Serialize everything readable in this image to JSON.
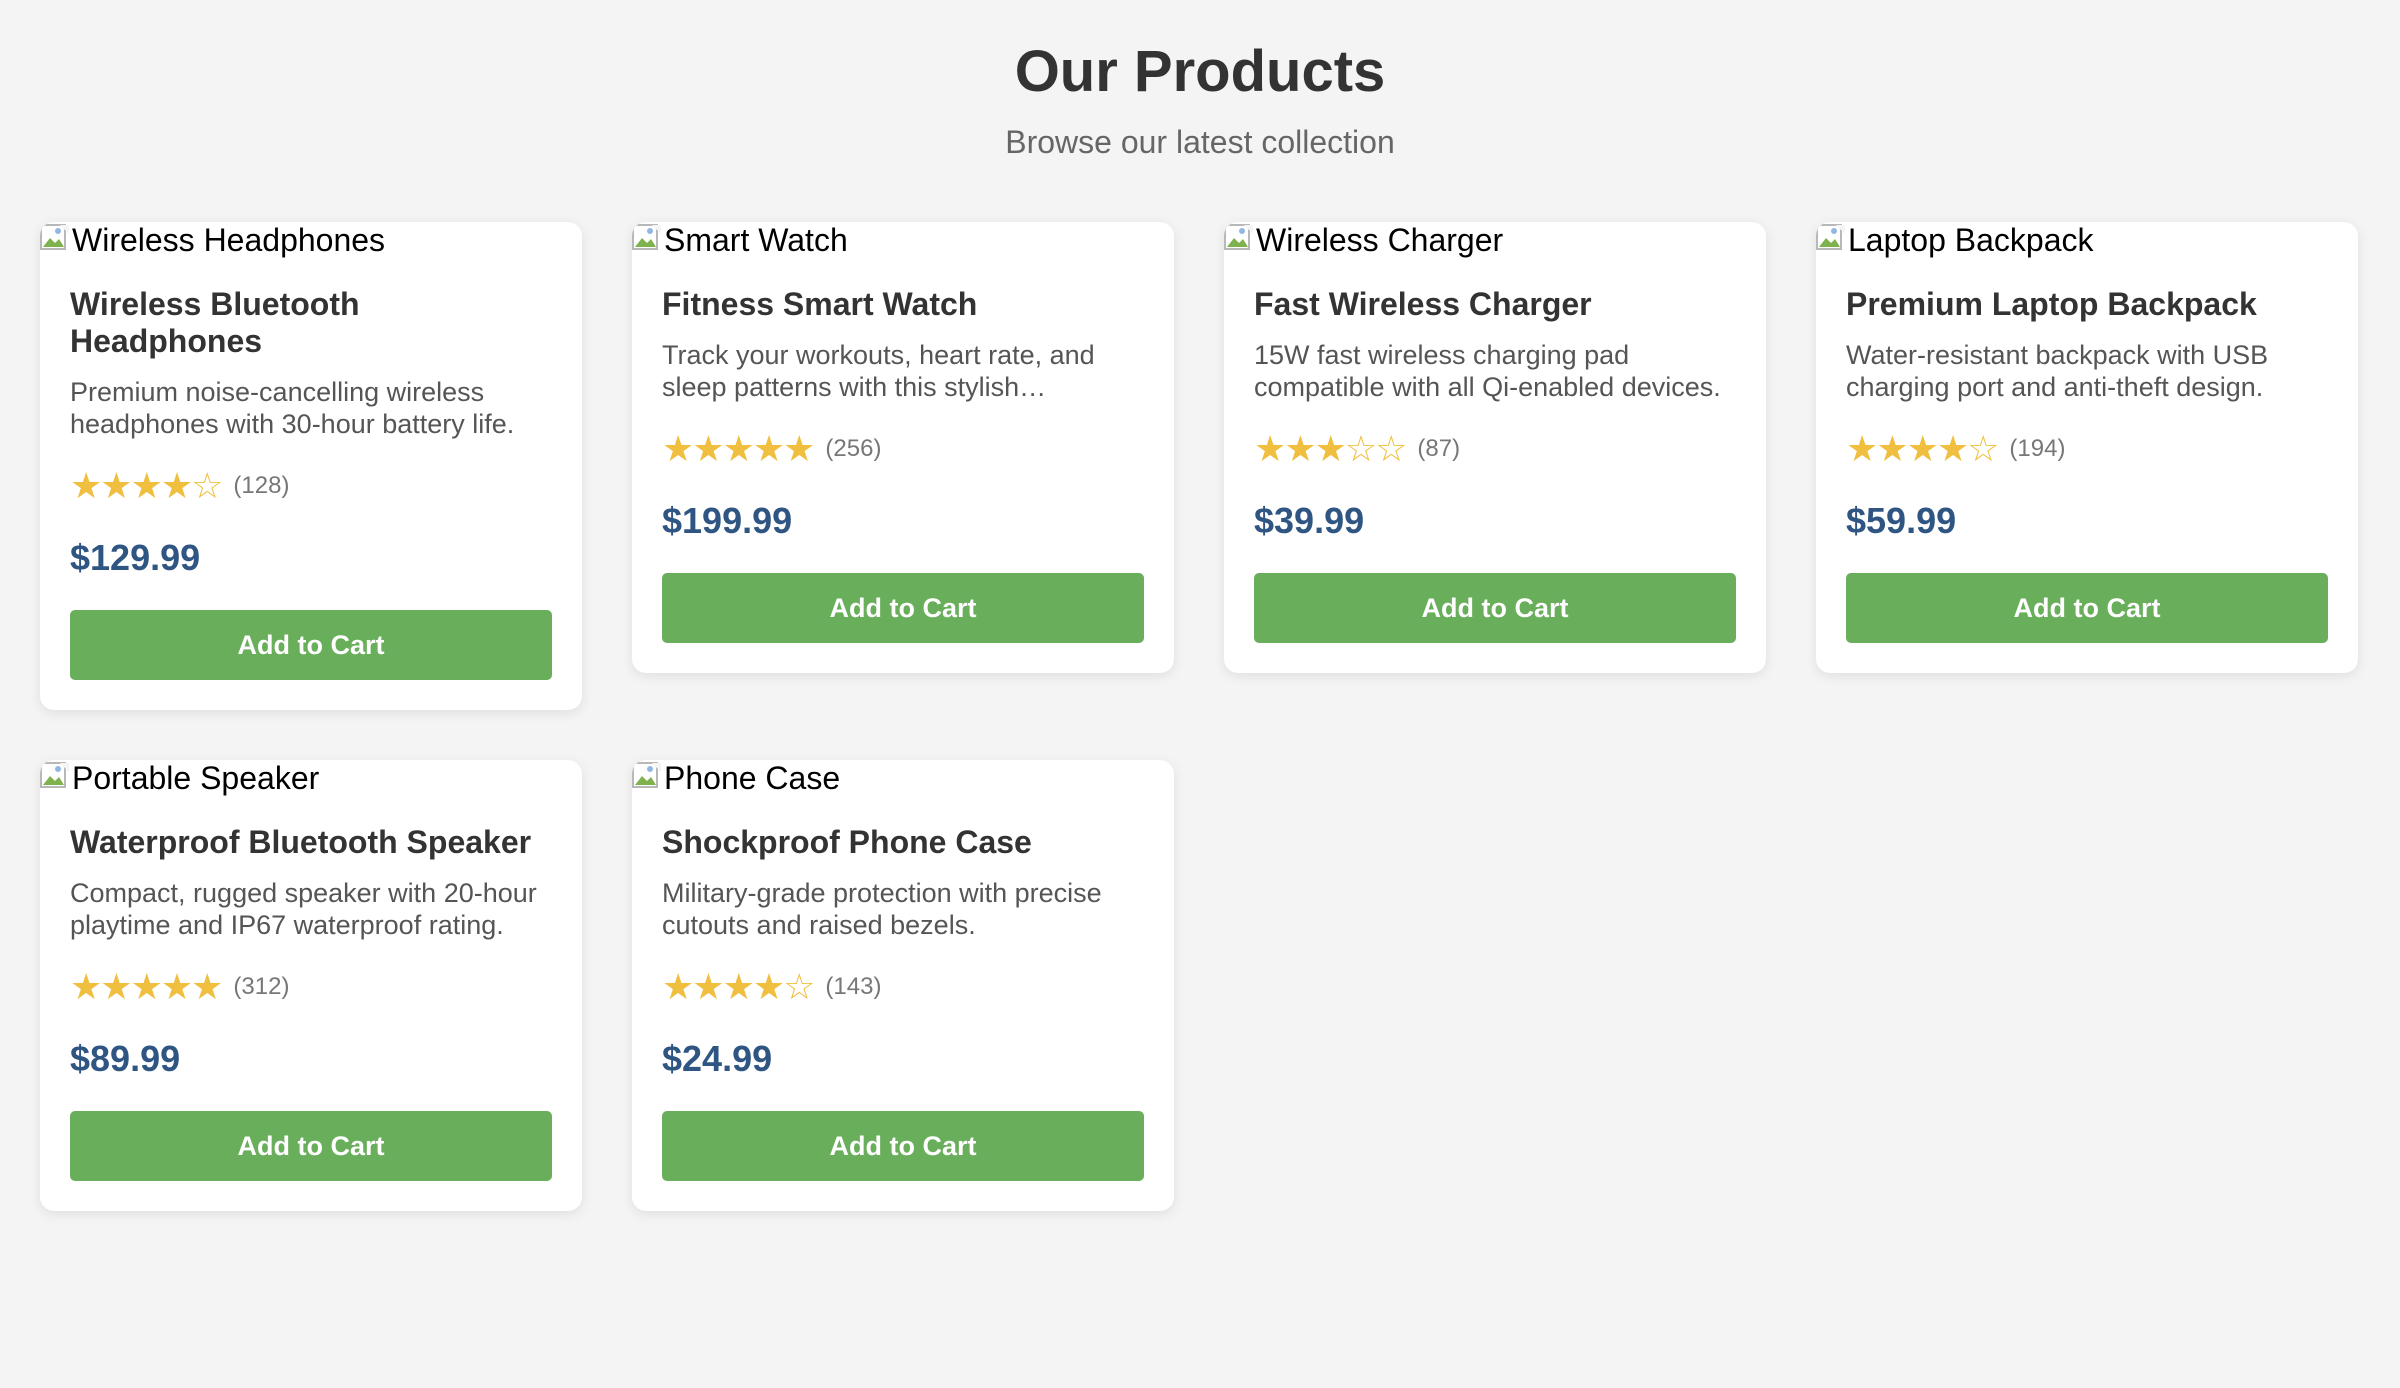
{
  "header": {
    "title": "Our Products",
    "subtitle": "Browse our latest collection"
  },
  "colors": {
    "background": "#f4f4f4",
    "price": "#2f5583",
    "button": "#69ae5a",
    "star": "#f0bf3f"
  },
  "icons": {
    "broken_image": "broken-image-icon",
    "star_filled": "star-filled-icon",
    "star_empty": "star-empty-icon"
  },
  "products": [
    {
      "image_alt": "Wireless Headphones",
      "name": "Wireless Bluetooth Headphones",
      "description": "Premium noise-cancelling wireless headphones with 30-hour battery life.",
      "rating": 4,
      "rating_max": 5,
      "review_count": "(128)",
      "price": "$129.99",
      "button_label": "Add to Cart"
    },
    {
      "image_alt": "Smart Watch",
      "name": "Fitness Smart Watch",
      "description": "Track your workouts, heart rate, and sleep patterns with this stylish smartwatch.",
      "rating": 5,
      "rating_max": 5,
      "review_count": "(256)",
      "price": "$199.99",
      "button_label": "Add to Cart"
    },
    {
      "image_alt": "Wireless Charger",
      "name": "Fast Wireless Charger",
      "description": "15W fast wireless charging pad compatible with all Qi-enabled devices.",
      "rating": 3,
      "rating_max": 5,
      "review_count": "(87)",
      "price": "$39.99",
      "button_label": "Add to Cart"
    },
    {
      "image_alt": "Laptop Backpack",
      "name": "Premium Laptop Backpack",
      "description": "Water-resistant backpack with USB charging port and anti-theft design.",
      "rating": 4,
      "rating_max": 5,
      "review_count": "(194)",
      "price": "$59.99",
      "button_label": "Add to Cart"
    },
    {
      "image_alt": "Portable Speaker",
      "name": "Waterproof Bluetooth Speaker",
      "description": "Compact, rugged speaker with 20-hour playtime and IP67 waterproof rating.",
      "rating": 5,
      "rating_max": 5,
      "review_count": "(312)",
      "price": "$89.99",
      "button_label": "Add to Cart"
    },
    {
      "image_alt": "Phone Case",
      "name": "Shockproof Phone Case",
      "description": "Military-grade protection with precise cutouts and raised bezels.",
      "rating": 4,
      "rating_max": 5,
      "review_count": "(143)",
      "price": "$24.99",
      "button_label": "Add to Cart"
    }
  ]
}
